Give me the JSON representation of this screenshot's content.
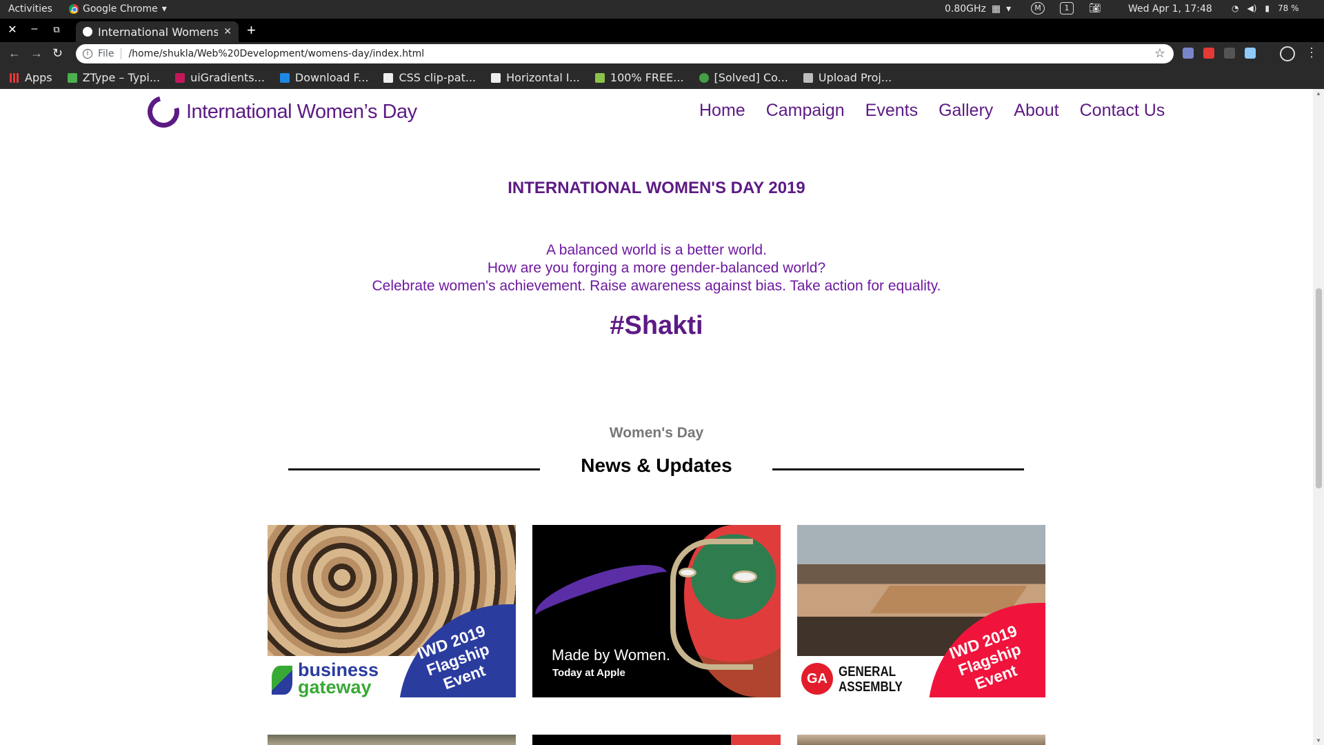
{
  "os_bar": {
    "activities": "Activities",
    "app": "Google Chrome",
    "cpu": "0.80GHz",
    "workspace": "1",
    "clock": "Wed Apr  1, 17:48",
    "battery": "78 %"
  },
  "browser": {
    "tab_title": "International Womens Day",
    "url_scheme": "File",
    "url": "/home/shukla/Web%20Development/womens-day/index.html",
    "bookmarks": [
      {
        "label": "Apps",
        "color": "#e53935"
      },
      {
        "label": "ZType – Typi...",
        "color": "#4caf50"
      },
      {
        "label": "uiGradients...",
        "color": "#c2185b"
      },
      {
        "label": "Download F...",
        "color": "#1e88e5"
      },
      {
        "label": "CSS clip-pat...",
        "color": "#eeeeee"
      },
      {
        "label": "Horizontal I...",
        "color": "#eeeeee"
      },
      {
        "label": "100% FREE...",
        "color": "#8bc34a"
      },
      {
        "label": "[Solved] Co...",
        "color": "#43a047"
      },
      {
        "label": "Upload Proj...",
        "color": "#bdbdbd"
      }
    ]
  },
  "site": {
    "logo_text": "International Women’s Day",
    "nav": [
      "Home",
      "Campaign",
      "Events",
      "Gallery",
      "About",
      "Contact Us"
    ],
    "hero": {
      "title": "INTERNATIONAL WOMEN'S DAY 2019",
      "lines": [
        "A balanced world is a better world.",
        "How are you forging a more gender-balanced world?",
        "Celebrate women's achievement. Raise awareness against bias. Take action for equality."
      ],
      "hashtag": "#Shakti"
    },
    "news": {
      "kicker": "Women's Day",
      "title": "News & Updates",
      "cards": [
        {
          "stamp": "IWD 2019\nFlagship\nEvent",
          "brand_line1": "business",
          "brand_line2": "gateway"
        },
        {
          "headline": "Made by Women.",
          "subline": "Today at Apple"
        },
        {
          "stamp": "IWD 2019\nFlagship\nEvent",
          "badge": "GA",
          "brand_line1": "GENERAL",
          "brand_line2": "ASSEMBLY"
        }
      ]
    }
  },
  "colors": {
    "brand_purple": "#5c1a84",
    "text_purple": "#6e19a0",
    "flagship_blue": "#2b3c9f",
    "flagship_red": "#f0143c"
  }
}
